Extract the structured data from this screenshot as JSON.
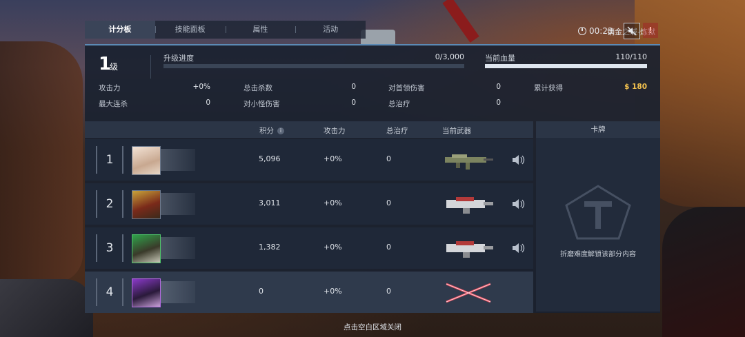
{
  "tabs": [
    {
      "label": "计分板",
      "active": true
    },
    {
      "label": "技能面板",
      "active": false
    },
    {
      "label": "属性",
      "active": false
    },
    {
      "label": "活动",
      "active": false
    }
  ],
  "hud": {
    "map_name": "销金之城-炼狱",
    "timer": "00:23"
  },
  "level": {
    "value": "1",
    "unit": "级"
  },
  "upgrade": {
    "label": "升级进度",
    "value": "0/3,000",
    "fraction": 0
  },
  "hp": {
    "label": "当前血量",
    "value": "110/110",
    "fraction": 1.0
  },
  "stats": {
    "attack_label": "攻击力",
    "attack_value": "+0%",
    "combo_label": "最大连杀",
    "combo_value": "0",
    "kills_label": "总击杀数",
    "kills_value": "0",
    "minion_label": "对小怪伤害",
    "minion_value": "0",
    "boss_label": "对首领伤害",
    "boss_value": "0",
    "heal_label": "总治疗",
    "heal_value": "0",
    "earned_label": "累计获得",
    "earned_currency": "$",
    "earned_value": "180"
  },
  "table": {
    "headers": {
      "score": "积分",
      "attack": "攻击力",
      "heal": "总治疗",
      "weapon": "当前武器"
    },
    "rows": [
      {
        "rank": "1",
        "score": "5,096",
        "attack": "+0%",
        "heal": "0",
        "weapon_icon": "assault-rifle-icon"
      },
      {
        "rank": "2",
        "score": "3,011",
        "attack": "+0%",
        "heal": "0",
        "weapon_icon": "heavy-cannon-icon"
      },
      {
        "rank": "3",
        "score": "1,382",
        "attack": "+0%",
        "heal": "0",
        "weapon_icon": "heavy-cannon-icon"
      },
      {
        "rank": "4",
        "score": "0",
        "attack": "+0%",
        "heal": "0",
        "weapon_icon": "crossed-blades-icon"
      }
    ]
  },
  "cards": {
    "title": "卡牌",
    "locked_message": "折磨难度解锁该部分内容"
  },
  "close_hint": "点击空白区域关闭",
  "colors": {
    "accent": "#5c8ab5",
    "gold": "#f2c14e",
    "panel": "#1a2230"
  }
}
